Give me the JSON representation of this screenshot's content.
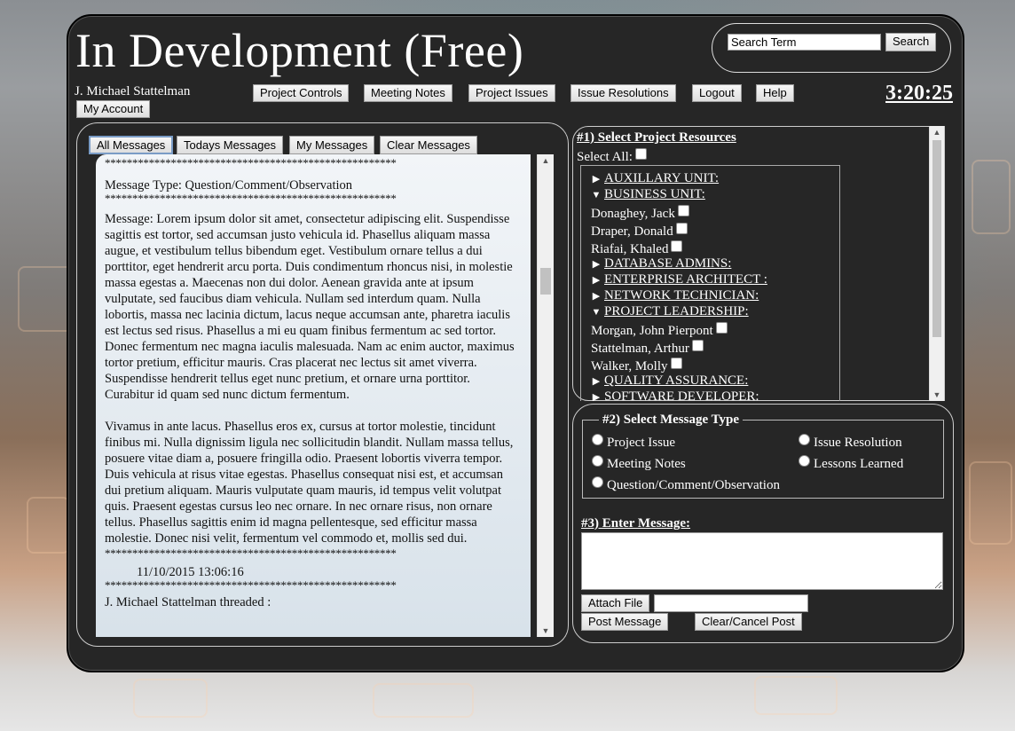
{
  "app": {
    "title": "In Development (Free)",
    "username": "J. Michael Stattelman",
    "clock": "3:20:25"
  },
  "search": {
    "placeholder": "Search Term",
    "value": "Search Term",
    "button": "Search"
  },
  "nav": {
    "my_account": "My Account",
    "items": [
      "Project Controls",
      "Meeting Notes",
      "Project Issues",
      "Issue Resolutions",
      "Logout",
      "Help"
    ]
  },
  "messages": {
    "tabs": [
      "All Messages",
      "Todays Messages",
      "My Messages",
      "Clear Messages"
    ],
    "active_tab": "All Messages",
    "stars": "*****************************************************",
    "type_line": "Message Type: Question/Comment/Observation",
    "body_1": "Message: Lorem ipsum dolor sit amet, consectetur adipiscing elit. Suspendisse sagittis est tortor, sed accumsan justo vehicula id. Phasellus aliquam massa augue, et vestibulum tellus bibendum eget. Vestibulum ornare tellus a dui porttitor, eget hendrerit arcu porta. Duis condimentum rhoncus nisi, in molestie massa egestas a. Maecenas non dui dolor. Aenean gravida ante at ipsum vulputate, sed faucibus diam vehicula. Nullam sed interdum quam. Nulla lobortis, massa nec lacinia dictum, lacus neque accumsan ante, pharetra iaculis est lectus sed risus. Phasellus a mi eu quam finibus fermentum ac sed tortor. Donec fermentum nec magna iaculis malesuada. Nam ac enim auctor, maximus tortor pretium, efficitur mauris. Cras placerat nec lectus sit amet viverra. Suspendisse hendrerit tellus eget nunc pretium, et ornare urna porttitor. Curabitur id quam sed nunc dictum fermentum.",
    "body_2": "Vivamus in ante lacus. Phasellus eros ex, cursus at tortor molestie, tincidunt finibus mi. Nulla dignissim ligula nec sollicitudin blandit. Nullam massa tellus, posuere vitae diam a, posuere fringilla odio. Praesent lobortis viverra tempor. Duis vehicula at risus vitae egestas. Phasellus consequat nisi est, et accumsan dui pretium aliquam. Mauris vulputate quam mauris, id tempus velit volutpat quis. Praesent egestas cursus leo nec ornare. In nec ornare risus, non ornare tellus. Phasellus sagittis enim id magna pellentesque, sed efficitur massa molestie. Donec nisi velit, fermentum vel commodo et, mollis sed dui.",
    "timestamp": "11/10/2015 13:06:16",
    "threaded_line": "J. Michael Stattelman threaded :"
  },
  "resources": {
    "title": "#1) Select Project Resources",
    "select_all": "Select All:",
    "groups": [
      {
        "label": "AUXILLARY UNIT:",
        "expanded": false,
        "members": []
      },
      {
        "label": "BUSINESS UNIT:",
        "expanded": true,
        "members": [
          "Donaghey, Jack",
          "Draper, Donald",
          "Riafai, Khaled"
        ]
      },
      {
        "label": "DATABASE ADMINS:",
        "expanded": false,
        "members": []
      },
      {
        "label": "ENTERPRISE ARCHITECT :",
        "expanded": false,
        "members": []
      },
      {
        "label": "NETWORK TECHNICIAN:",
        "expanded": false,
        "members": []
      },
      {
        "label": "PROJECT LEADERSHIP:",
        "expanded": true,
        "members": [
          "Morgan, John Pierpont",
          "Stattelman, Arthur",
          "Walker, Molly"
        ]
      },
      {
        "label": "QUALITY ASSURANCE:",
        "expanded": false,
        "members": []
      },
      {
        "label": "SOFTWARE DEVELOPER:",
        "expanded": false,
        "members": []
      }
    ]
  },
  "message_type": {
    "legend": "#2) Select Message Type",
    "options": [
      "Project Issue",
      "Issue Resolution",
      "Meeting Notes",
      "Lessons Learned",
      "Question/Comment/Observation"
    ]
  },
  "compose": {
    "label": "#3) Enter Message:",
    "attach": "Attach File",
    "post": "Post Message",
    "clear": "Clear/Cancel Post"
  }
}
